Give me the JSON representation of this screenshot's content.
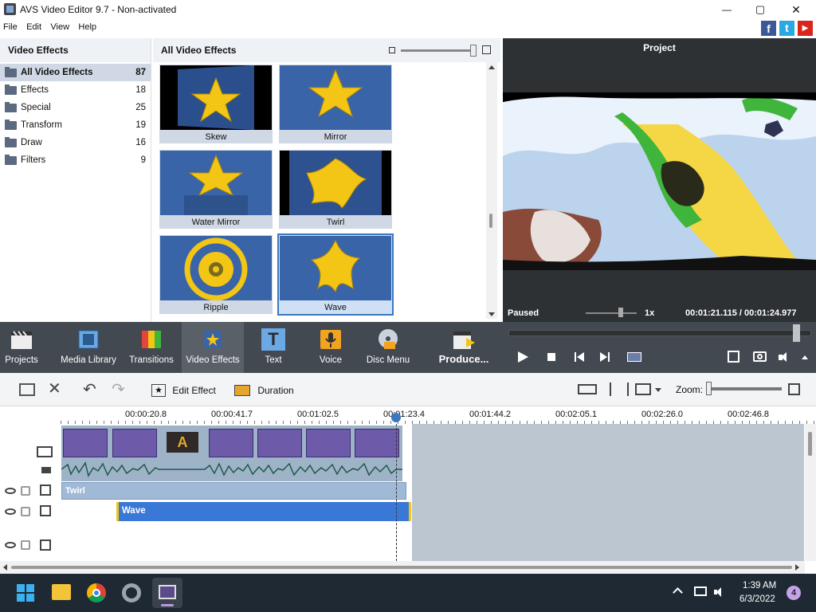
{
  "window": {
    "title": "AVS Video Editor 9.7 - Non-activated",
    "minimize": "—",
    "maximize": "▢",
    "close": "✕"
  },
  "menu": [
    "File",
    "Edit",
    "View",
    "Help"
  ],
  "social": {
    "facebook": "f",
    "twitter": "t",
    "youtube": "▶"
  },
  "categories": {
    "header": "Video Effects",
    "items": [
      {
        "label": "All Video Effects",
        "count": "87"
      },
      {
        "label": "Effects",
        "count": "18"
      },
      {
        "label": "Special",
        "count": "25"
      },
      {
        "label": "Transform",
        "count": "19"
      },
      {
        "label": "Draw",
        "count": "16"
      },
      {
        "label": "Filters",
        "count": "9"
      }
    ]
  },
  "effects": {
    "header": "All Video Effects",
    "items": [
      {
        "label": "Skew"
      },
      {
        "label": "Mirror"
      },
      {
        "label": "Water Mirror"
      },
      {
        "label": "Twirl"
      },
      {
        "label": "Ripple"
      },
      {
        "label": "Wave",
        "selected": true
      }
    ]
  },
  "preview": {
    "title": "Project",
    "status": "Paused",
    "speed": "1x",
    "current_time": "00:01:21.115",
    "separator": "/",
    "total_time": "00:01:24.977"
  },
  "toolbar": {
    "items": [
      "Projects",
      "Media Library",
      "Transitions",
      "Video Effects",
      "Text",
      "Voice",
      "Disc Menu"
    ],
    "produce": "Produce...",
    "text_icon_glyph": "T"
  },
  "timeline_toolbar": {
    "edit_effect": "Edit Effect",
    "duration": "Duration",
    "zoom": "Zoom:"
  },
  "ruler": {
    "ticks": [
      "00:00:20.8",
      "00:00:41.7",
      "00:01:02.5",
      "00:01:23.4",
      "00:01:44.2",
      "00:02:05.1",
      "00:02:26.0",
      "00:02:46.8"
    ]
  },
  "tracks": {
    "effect1": "Twirl",
    "effect2": "Wave",
    "text_clip_glyph": "A"
  },
  "taskbar": {
    "time": "1:39 AM",
    "date": "6/3/2022",
    "notifications": "4"
  },
  "colors": {
    "accent": "#3b78c2",
    "toolbar_bg": "#434950",
    "effect_blue": "#3a78d8",
    "effect_light": "#9fb9d6"
  }
}
